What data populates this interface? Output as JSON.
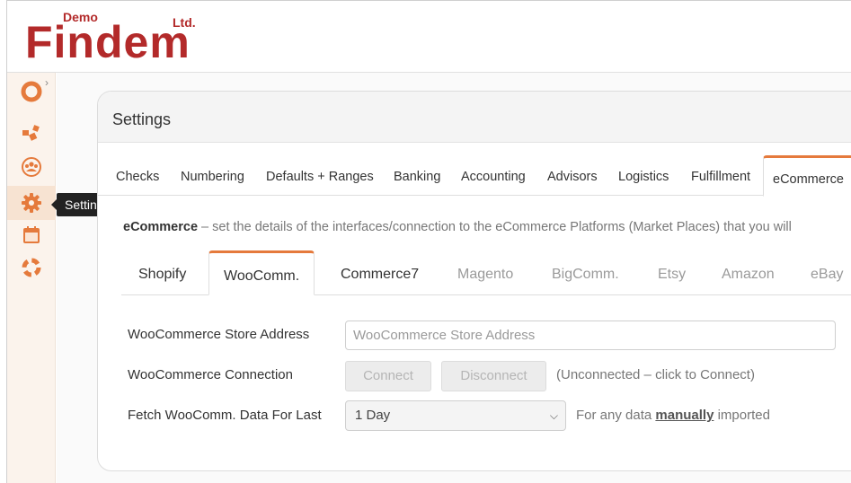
{
  "brand": {
    "demo": "Demo",
    "name": "Findem",
    "ltd": "Ltd."
  },
  "sidebar": {
    "items": [
      {
        "icon": "spinner-icon"
      },
      {
        "icon": "boxes-icon"
      },
      {
        "icon": "people-icon"
      },
      {
        "icon": "gear-icon"
      },
      {
        "icon": "calendar-icon"
      },
      {
        "icon": "lifebuoy-icon"
      }
    ],
    "tooltip": "Settings"
  },
  "settings": {
    "title": "Settings",
    "tabs": [
      "Checks",
      "Numbering",
      "Defaults + Ranges",
      "Banking",
      "Accounting",
      "Advisors",
      "Logistics",
      "Fulfillment",
      "eCommerce"
    ],
    "active_tab": "eCommerce",
    "description_bold": "eCommerce",
    "description_rest": " – set the details of the interfaces/connection to the eCommerce Platforms (Market Places) that you will",
    "subtabs": [
      "Shopify",
      "WooComm.",
      "Commerce7",
      "Magento",
      "BigComm.",
      "Etsy",
      "Amazon",
      "eBay"
    ],
    "active_subtab": "WooComm."
  },
  "woo": {
    "store_label": "WooCommerce Store Address",
    "store_placeholder": "WooCommerce Store Address",
    "connection_label": "WooCommerce Connection",
    "connect_label": "Connect",
    "disconnect_label": "Disconnect",
    "connection_status": "(Unconnected – click to Connect)",
    "fetch_label": "Fetch WooComm. Data For Last",
    "fetch_value": "1 Day",
    "fetch_note_pre": "For any data ",
    "fetch_note_link": "manually",
    "fetch_note_post": " imported"
  },
  "colors": {
    "accent": "#e57a3c",
    "brand": "#b32a2a"
  }
}
